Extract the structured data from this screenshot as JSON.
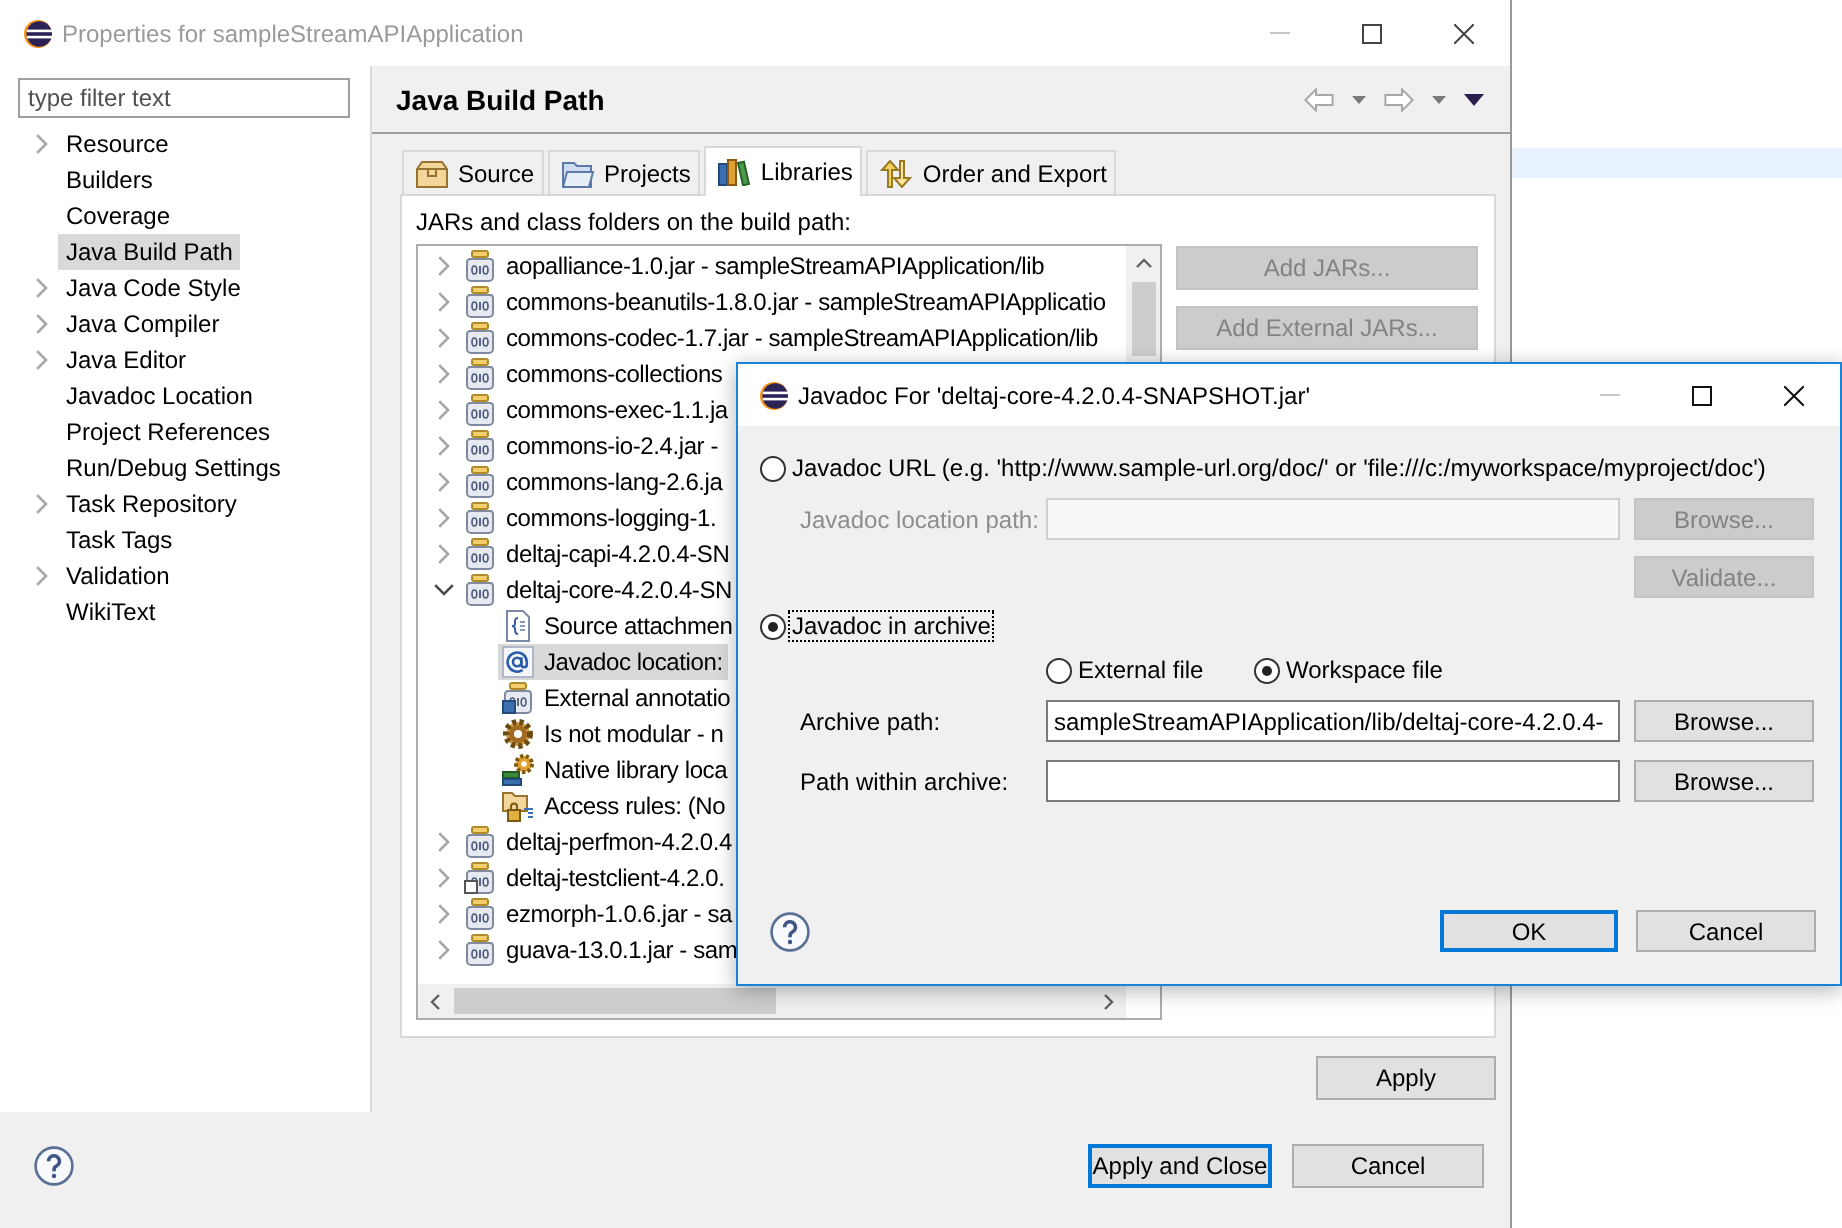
{
  "main_window": {
    "title": "Properties for sampleStreamAPIApplication",
    "filter": {
      "placeholder": "type filter text"
    },
    "sidebar": {
      "items": [
        {
          "label": "Resource",
          "expandable": true,
          "selected": false
        },
        {
          "label": "Builders",
          "expandable": false,
          "selected": false
        },
        {
          "label": "Coverage",
          "expandable": false,
          "selected": false
        },
        {
          "label": "Java Build Path",
          "expandable": false,
          "selected": true
        },
        {
          "label": "Java Code Style",
          "expandable": true,
          "selected": false
        },
        {
          "label": "Java Compiler",
          "expandable": true,
          "selected": false
        },
        {
          "label": "Java Editor",
          "expandable": true,
          "selected": false
        },
        {
          "label": "Javadoc Location",
          "expandable": false,
          "selected": false
        },
        {
          "label": "Project References",
          "expandable": false,
          "selected": false
        },
        {
          "label": "Run/Debug Settings",
          "expandable": false,
          "selected": false
        },
        {
          "label": "Task Repository",
          "expandable": true,
          "selected": false
        },
        {
          "label": "Task Tags",
          "expandable": false,
          "selected": false
        },
        {
          "label": "Validation",
          "expandable": true,
          "selected": false
        },
        {
          "label": "WikiText",
          "expandable": false,
          "selected": false
        }
      ]
    },
    "page": {
      "title": "Java Build Path",
      "tabs": [
        {
          "kind": "source",
          "label": "Source",
          "selected": false
        },
        {
          "kind": "projects",
          "label": "Projects",
          "selected": false
        },
        {
          "kind": "libraries",
          "label": "Libraries",
          "selected": true
        },
        {
          "kind": "order",
          "label": "Order and Export",
          "selected": false
        }
      ],
      "caption": "JARs and class folders on the build path:",
      "tree": [
        {
          "kind": "jar",
          "label": "aopalliance-1.0.jar - sampleStreamAPIApplication/lib",
          "expanded": false,
          "selected": false
        },
        {
          "kind": "jar",
          "label": "commons-beanutils-1.8.0.jar - sampleStreamAPIApplicatio",
          "expanded": false,
          "selected": false
        },
        {
          "kind": "jar",
          "label": "commons-codec-1.7.jar - sampleStreamAPIApplication/lib",
          "expanded": false,
          "selected": false
        },
        {
          "kind": "jar",
          "label": "commons-collections",
          "expanded": false,
          "selected": false
        },
        {
          "kind": "jar",
          "label": "commons-exec-1.1.ja",
          "expanded": false,
          "selected": false
        },
        {
          "kind": "jar",
          "label": "commons-io-2.4.jar -",
          "expanded": false,
          "selected": false
        },
        {
          "kind": "jar",
          "label": "commons-lang-2.6.ja",
          "expanded": false,
          "selected": false
        },
        {
          "kind": "jar",
          "label": "commons-logging-1.",
          "expanded": false,
          "selected": false
        },
        {
          "kind": "jar",
          "label": "deltaj-capi-4.2.0.4-SN",
          "expanded": false,
          "selected": false
        },
        {
          "kind": "jar",
          "label": "deltaj-core-4.2.0.4-SN",
          "expanded": true,
          "selected": false,
          "children": [
            {
              "kind": "source",
              "label": "Source attachmen",
              "selected": false
            },
            {
              "kind": "javadoc",
              "label": "Javadoc location:",
              "selected": true
            },
            {
              "kind": "annotations",
              "label": "External annotatio",
              "selected": false
            },
            {
              "kind": "module",
              "label": "Is not modular - n",
              "selected": false
            },
            {
              "kind": "native",
              "label": "Native library loca",
              "selected": false
            },
            {
              "kind": "access",
              "label": "Access rules: (No",
              "selected": false
            }
          ]
        },
        {
          "kind": "jar",
          "label": "deltaj-perfmon-4.2.0.4",
          "expanded": false,
          "selected": false
        },
        {
          "kind": "linked",
          "label": "deltaj-testclient-4.2.0.",
          "expanded": false,
          "selected": false
        },
        {
          "kind": "jar",
          "label": "ezmorph-1.0.6.jar - sa",
          "expanded": false,
          "selected": false
        },
        {
          "kind": "jar",
          "label": "guava-13.0.1.jar - sam",
          "expanded": false,
          "selected": false
        }
      ],
      "side_buttons": [
        {
          "label": "Add JARs...",
          "disabled": true
        },
        {
          "label": "Add External JARs...",
          "disabled": true
        }
      ],
      "apply": {
        "label": "Apply"
      }
    },
    "buttons": [
      {
        "label": "Apply and Close",
        "default": true
      },
      {
        "label": "Cancel",
        "default": false
      }
    ]
  },
  "dialog": {
    "title": "Javadoc For 'deltaj-core-4.2.0.4-SNAPSHOT.jar'",
    "url_option": {
      "label": "Javadoc URL (e.g. 'http://www.sample-url.org/doc/' or 'file:///c:/myworkspace/myproject/doc')",
      "selected": false,
      "focused": false,
      "location": {
        "label": "Javadoc location path:",
        "disabled": true
      },
      "browse": {
        "label": "Browse...",
        "disabled": true
      },
      "validate": {
        "label": "Validate...",
        "disabled": true
      }
    },
    "archive_option": {
      "label": "Javadoc in archive",
      "selected": true,
      "focused": true,
      "sources": [
        {
          "label": "External file",
          "selected": false
        },
        {
          "label": "Workspace file",
          "selected": true
        }
      ],
      "fields": [
        {
          "label": "Archive path:",
          "value": "sampleStreamAPIApplication/lib/deltaj-core-4.2.0.4-",
          "browse": {
            "label": "Browse...",
            "disabled": false
          }
        },
        {
          "label": "Path within archive:",
          "browse": {
            "label": "Browse...",
            "disabled": false
          }
        }
      ]
    },
    "buttons": [
      {
        "label": "OK",
        "default": true
      },
      {
        "label": "Cancel",
        "default": false
      }
    ]
  }
}
